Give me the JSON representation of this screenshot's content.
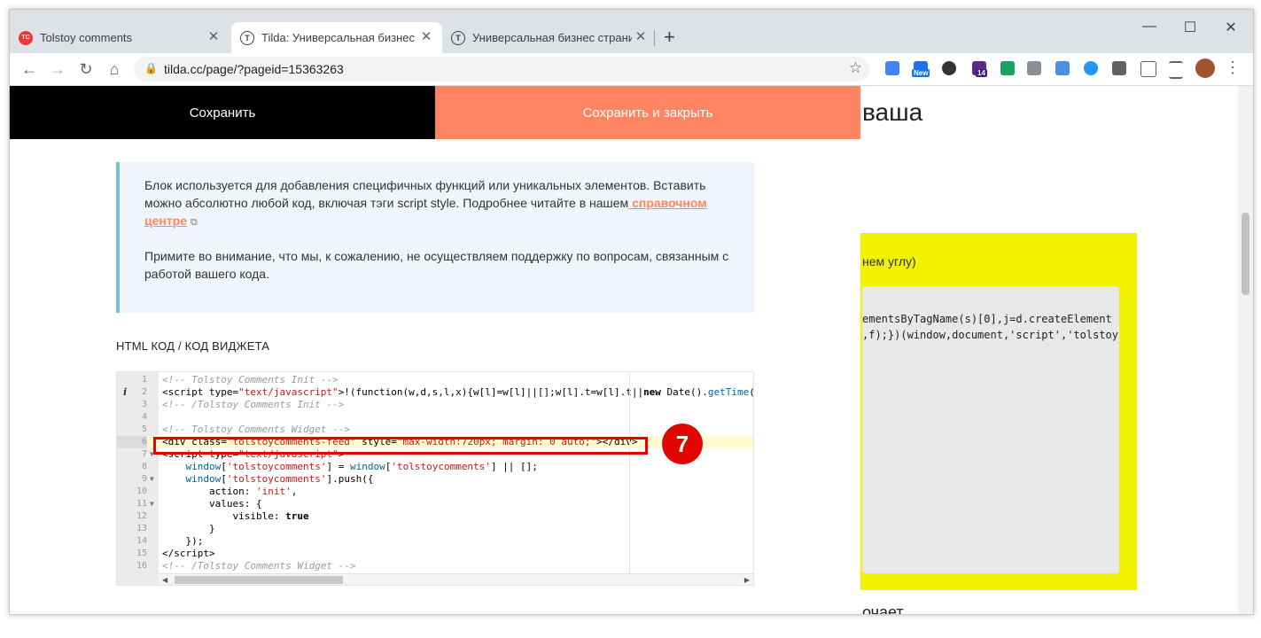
{
  "browser": {
    "tabs": [
      {
        "title": "Tolstoy comments",
        "favicon": "TC"
      },
      {
        "title": "Tilda: Универсальная бизнес стр",
        "favicon": "T"
      },
      {
        "title": "Универсальная бизнес страниц",
        "favicon": "T"
      }
    ],
    "new_tab_label": "+",
    "window_controls": {
      "minimize": "—",
      "maximize": "☐",
      "close": "✕"
    },
    "url": "tilda.cc/page/?pageid=15363263",
    "extensions": {
      "new_badge": "New",
      "count_badge": "14"
    }
  },
  "editor": {
    "save_label": "Сохранить",
    "save_close_label": "Сохранить и закрыть",
    "info": {
      "p1_text": "Блок используется для добавления специфичных функций или уникальных элементов. Вставить можно абсолютно любой код, включая тэги script style. Подробнее читайте в нашем",
      "p1_link": " справочном центре",
      "p2_text": "Примите во внимание, что мы, к сожалению, не осуществляем поддержку по вопросам, связанным с работой вашего кода."
    },
    "code_label": "HTML КОД / КОД ВИДЖЕТА",
    "code_lines": [
      {
        "num": "1",
        "html": "<span class='t-cm'>&lt;!-- Tolstoy Comments Init --&gt;</span>"
      },
      {
        "num": "2",
        "html": "&lt;script type=<span class='t-str'>\"text/javascript\"</span>&gt;!(function(w,d,s,l,x){w[l]=w[l]||[];w[l].t=w[l].t||<span class='t-kw'>new</span> Date().<span class='t-fn'>getTime</span>("
      },
      {
        "num": "3",
        "html": "<span class='t-cm'>&lt;!-- /Tolstoy Comments Init --&gt;</span>"
      },
      {
        "num": "4",
        "html": ""
      },
      {
        "num": "5",
        "html": "<span class='t-cm'>&lt;!-- Tolstoy Comments Widget --&gt;</span>"
      },
      {
        "num": "6",
        "html": "&lt;div class=<span class='t-str'>\"tolstoycomments-feed\"</span> style=<span class='t-str'>\"max-width:720px; margin: 0 auto;\"</span>&gt;&lt;/div&gt;"
      },
      {
        "num": "7",
        "html": "&lt;script type=<span class='t-str'>\"text/javascript\"</span>&gt;"
      },
      {
        "num": "8",
        "html": "    <span class='t-fn'>window</span>[<span class='t-str'>'tolstoycomments'</span>] = <span class='t-fn'>window</span>[<span class='t-str'>'tolstoycomments'</span>] || [];"
      },
      {
        "num": "9",
        "html": "    <span class='t-fn'>window</span>[<span class='t-str'>'tolstoycomments'</span>].push({"
      },
      {
        "num": "10",
        "html": "        action: <span class='t-str'>'init'</span>,"
      },
      {
        "num": "11",
        "html": "        values: {"
      },
      {
        "num": "12",
        "html": "            visible: <span class='t-kw'>true</span>"
      },
      {
        "num": "13",
        "html": "        }"
      },
      {
        "num": "14",
        "html": "    });"
      },
      {
        "num": "15",
        "html": "&lt;/script&gt;"
      },
      {
        "num": "16",
        "html": "<span class='t-cm'>&lt;!-- /Tolstoy Comments Widget --&gt;</span>"
      }
    ],
    "annotation_badge": "7"
  },
  "background_page": {
    "heading": "ваша",
    "yellow_text": "нем углу)",
    "code_line1": "ementsByTagName(s)[0],j=d.createElement",
    "code_line2": ",f);})(window,document,'script','tolstoy",
    "bottom_text": "очает"
  },
  "colors": {
    "save_bg": "#000000",
    "save_close_bg": "#ff8562",
    "link": "#ff8562",
    "highlight": "#e10600",
    "yellow": "#f2f200"
  }
}
